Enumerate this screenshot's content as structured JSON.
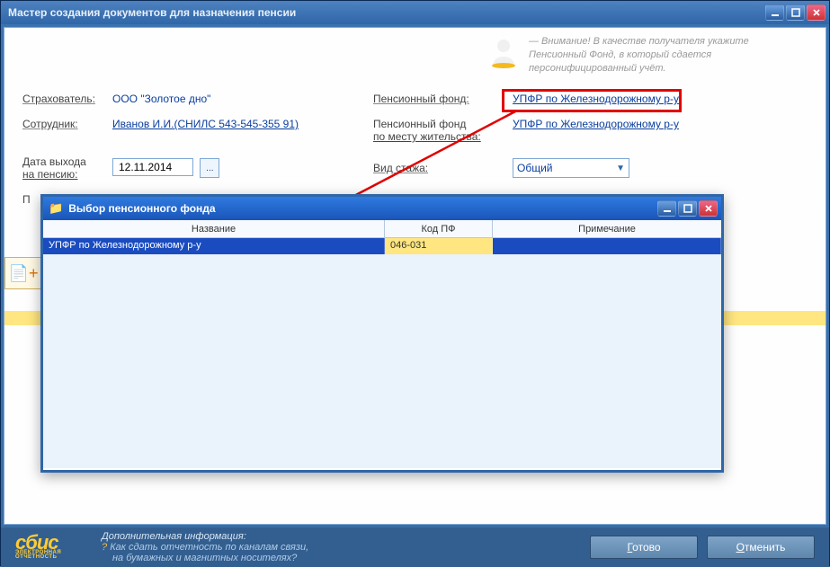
{
  "window": {
    "title": "Мастер создания документов для назначения пенсии"
  },
  "attention": {
    "line1": "— Внимание! В качестве получателя укажите",
    "line2": "Пенсионный Фонд, в который сдается",
    "line3": "персонифицированный учёт."
  },
  "form": {
    "insurer_label": "Страхователь:",
    "insurer_value": "ООО \"Золотое дно\"",
    "employee_label": "Сотрудник:",
    "employee_value": "Иванов И.И.(СНИЛС 543-545-355 91)",
    "retire_date_label_l1": "Дата выхода",
    "retire_date_label_l2": "на пенсию:",
    "retire_date_value": "12.11.2014",
    "pension_fund_label": "Пенсионный фонд:",
    "pension_fund_value": "УПФР по Железнодорожному р-у",
    "residence_fund_label_l1": "Пенсионный фонд",
    "residence_fund_label_l2": "по месту жительства:",
    "residence_fund_value": "УПФР по Железнодорожному р-у",
    "seniority_label": "Вид стажа:",
    "seniority_value": "Общий",
    "left_cut_label": "П"
  },
  "dialog": {
    "title": "Выбор пенсионного фонда",
    "col_name": "Название",
    "col_code": "Код ПФ",
    "col_note": "Примечание",
    "row1_name": "УПФР по Железнодорожному р-у",
    "row1_code": "046-031",
    "row1_note": ""
  },
  "footer": {
    "logo": "сбис",
    "logo_sub": "ЭЛЕКТРОННАЯ ОТЧЕТНОСТЬ",
    "info_title": "Дополнительная информация:",
    "info_l1": "Как сдать отчетность по каналам связи,",
    "info_l2": "на бумажных и магнитных носителях?",
    "btn_ok": "Готово",
    "btn_cancel": "Отменить"
  }
}
